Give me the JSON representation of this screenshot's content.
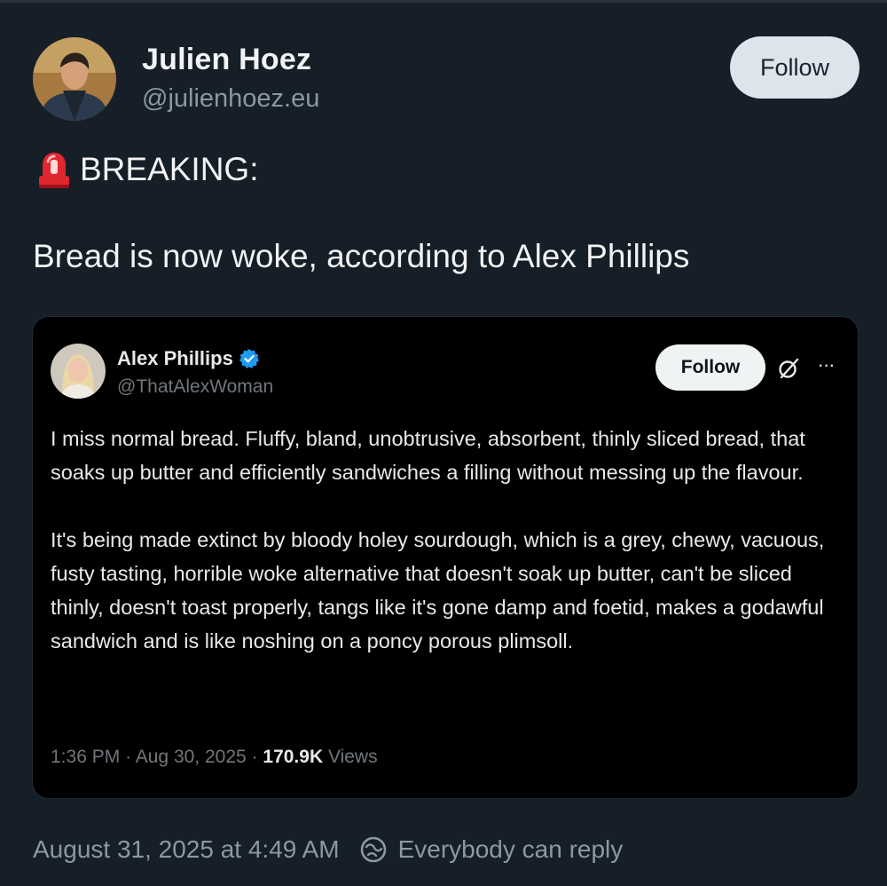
{
  "post": {
    "author": {
      "name": "Julien Hoez",
      "handle": "@julienhoez.eu"
    },
    "follow_label": "Follow",
    "icon_breaking": "siren-icon",
    "breaking_text": "BREAKING:",
    "body_text": "Bread is now woke, according to Alex Phillips",
    "timestamp": "August 31, 2025 at 4:49 AM",
    "reply_icon": "reply-circle-icon",
    "reply_setting": "Everybody can reply"
  },
  "embed": {
    "author": {
      "name": "Alex Phillips",
      "handle": "@ThatAlexWoman",
      "verified": true
    },
    "follow_label": "Follow",
    "paragraphs": [
      "I miss normal bread. Fluffy, bland, unobtrusive, absorbent, thinly sliced bread, that soaks up butter and efficiently sandwiches a filling without messing up the flavour.",
      "It's being made extinct by bloody holey sourdough, which is a grey, chewy, vacuous, fusty tasting, horrible woke alternative that doesn't soak up butter, can't be sliced thinly, doesn't toast properly, tangs like it's gone damp and foetid, makes a godawful sandwich and is like noshing on a poncy porous plimsoll."
    ],
    "time": "1:36 PM",
    "separator": "·",
    "date": "Aug 30, 2025",
    "views_count": "170.9K",
    "views_label": "Views"
  },
  "colors": {
    "background": "#161e27",
    "embed_background": "#000000",
    "accent_verified": "#1d9bf0",
    "muted_text": "#8b98a5"
  }
}
